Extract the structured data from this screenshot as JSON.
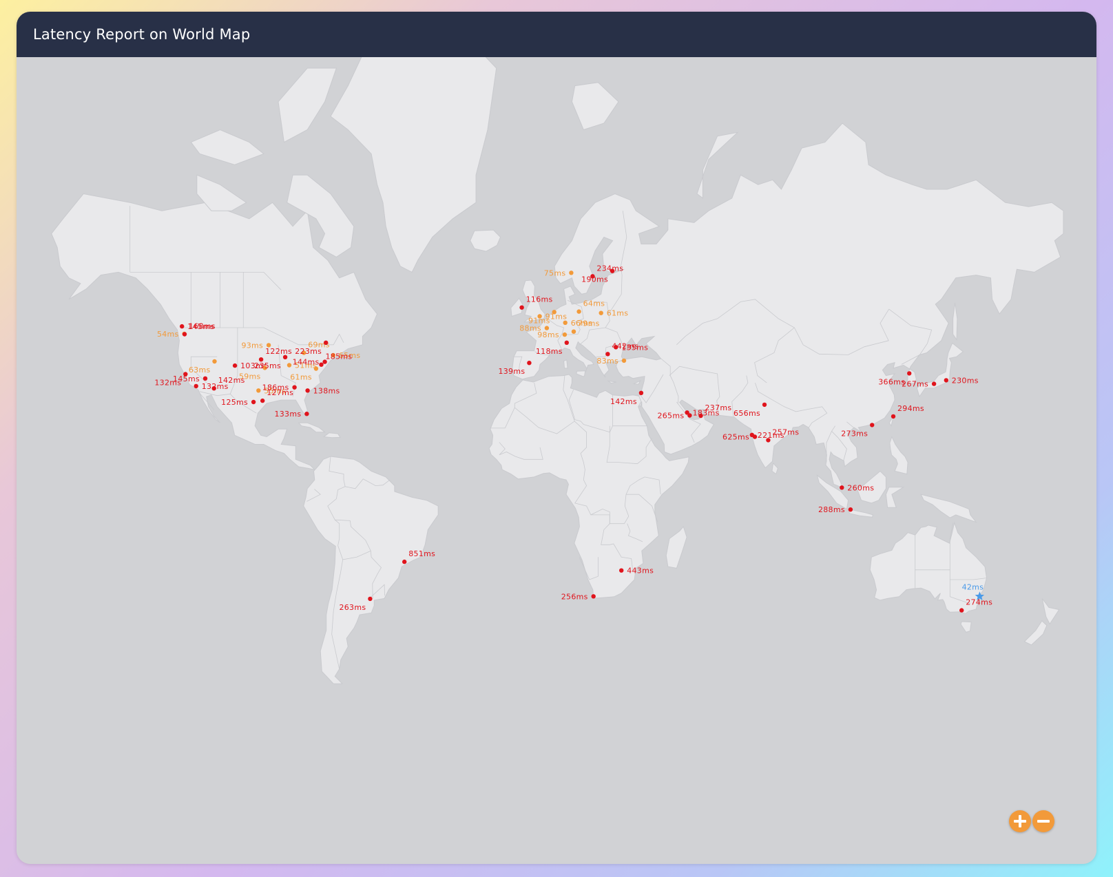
{
  "header": {
    "title": "Latency Report on World Map"
  },
  "colors": {
    "header_bg": "#283047",
    "ocean": "#d1d2d5",
    "land": "#e9e9eb",
    "high_latency": "#e0141c",
    "medium_latency": "#f29a3a",
    "home_node": "#4a9ae8"
  },
  "controls": {
    "zoom_in_icon": "plus-icon",
    "zoom_out_icon": "minus-icon"
  },
  "markers": [
    {
      "label": "145ms",
      "level": "high",
      "lat": 49.3,
      "lon": -123.1
    },
    {
      "label": "54ms",
      "level": "medium",
      "lat": 47.6,
      "lon": -122.3
    },
    {
      "label": "168ms",
      "level": "high",
      "lat": 47.5,
      "lon": -122.2
    },
    {
      "label": "132ms",
      "level": "high",
      "lat": 37.4,
      "lon": -121.9
    },
    {
      "label": "132ms",
      "level": "high",
      "lat": 34.05,
      "lon": -118.25
    },
    {
      "label": "145ms",
      "level": "high",
      "lat": 36.2,
      "lon": -115.1
    },
    {
      "label": "142ms",
      "level": "high",
      "lat": 33.4,
      "lon": -112.1
    },
    {
      "label": "63ms",
      "level": "medium",
      "lat": 40.8,
      "lon": -111.9
    },
    {
      "label": "103ms",
      "level": "high",
      "lat": 39.7,
      "lon": -104.9
    },
    {
      "label": "93ms",
      "level": "medium",
      "lat": 44.9,
      "lon": -93.3
    },
    {
      "label": "122ms",
      "level": "high",
      "lat": 41.3,
      "lon": -95.9
    },
    {
      "label": "59ms",
      "level": "medium",
      "lat": 39.1,
      "lon": -94.6
    },
    {
      "label": "55ms",
      "level": "medium",
      "lat": 32.8,
      "lon": -96.8
    },
    {
      "label": "125ms",
      "level": "high",
      "lat": 29.4,
      "lon": -98.5
    },
    {
      "label": "127ms",
      "level": "high",
      "lat": 29.8,
      "lon": -95.4
    },
    {
      "label": "235ms",
      "level": "high",
      "lat": 41.9,
      "lon": -87.6
    },
    {
      "label": "51ms",
      "level": "medium",
      "lat": 39.8,
      "lon": -86.2
    },
    {
      "label": "186ms",
      "level": "high",
      "lat": 33.7,
      "lon": -84.4
    },
    {
      "label": "69ms",
      "level": "medium",
      "lat": 43.0,
      "lon": -81.2
    },
    {
      "label": "223ms",
      "level": "high",
      "lat": 45.5,
      "lon": -73.6
    },
    {
      "label": "65ms",
      "level": "medium",
      "lat": 42.4,
      "lon": -71.1
    },
    {
      "label": "144ms",
      "level": "high",
      "lat": 40.7,
      "lon": -74.0
    },
    {
      "label": "185ms",
      "level": "high",
      "lat": 39.95,
      "lon": -75.2
    },
    {
      "label": "61ms",
      "level": "medium",
      "lat": 38.9,
      "lon": -77.0
    },
    {
      "label": "138ms",
      "level": "high",
      "lat": 32.8,
      "lon": -79.9
    },
    {
      "label": "133ms",
      "level": "high",
      "lat": 25.8,
      "lon": -80.2
    },
    {
      "label": "116ms",
      "level": "high",
      "lat": 53.35,
      "lon": -6.26
    },
    {
      "label": "139ms",
      "level": "high",
      "lat": 40.4,
      "lon": -3.7
    },
    {
      "label": "91ms",
      "level": "medium",
      "lat": 51.5,
      "lon": -0.1
    },
    {
      "label": "88ms",
      "level": "medium",
      "lat": 48.9,
      "lon": 2.35
    },
    {
      "label": "64ms",
      "level": "medium",
      "lat": 52.5,
      "lon": 13.4
    },
    {
      "label": "91ms",
      "level": "medium",
      "lat": 52.4,
      "lon": 4.9
    },
    {
      "label": "66ms",
      "level": "medium",
      "lat": 50.1,
      "lon": 8.7
    },
    {
      "label": "98ms",
      "level": "medium",
      "lat": 47.4,
      "lon": 8.5
    },
    {
      "label": "79ms",
      "level": "medium",
      "lat": 48.1,
      "lon": 11.6
    },
    {
      "label": "118ms",
      "level": "high",
      "lat": 45.5,
      "lon": 9.2
    },
    {
      "label": "61ms",
      "level": "medium",
      "lat": 52.2,
      "lon": 21.0
    },
    {
      "label": "75ms",
      "level": "medium",
      "lat": 59.9,
      "lon": 10.75
    },
    {
      "label": "234ms",
      "level": "high",
      "lat": 59.3,
      "lon": 18.1
    },
    {
      "label": "190ms",
      "level": "high",
      "lat": 60.2,
      "lon": 24.9
    },
    {
      "label": "135ms",
      "level": "high",
      "lat": 44.4,
      "lon": 26.1
    },
    {
      "label": "83ms",
      "level": "medium",
      "lat": 41.0,
      "lon": 28.9
    },
    {
      "label": "442ms",
      "level": "high",
      "lat": 42.7,
      "lon": 23.3
    },
    {
      "label": "142ms",
      "level": "high",
      "lat": 32.1,
      "lon": 34.8
    },
    {
      "label": "183ms",
      "level": "high",
      "lat": 26.2,
      "lon": 50.6
    },
    {
      "label": "265ms",
      "level": "high",
      "lat": 25.3,
      "lon": 51.5
    },
    {
      "label": "237ms",
      "level": "high",
      "lat": 25.2,
      "lon": 55.3
    },
    {
      "label": "656ms",
      "level": "high",
      "lat": 28.6,
      "lon": 77.2
    },
    {
      "label": "221ms",
      "level": "high",
      "lat": 19.1,
      "lon": 72.9
    },
    {
      "label": "625ms",
      "level": "high",
      "lat": 18.5,
      "lon": 73.9
    },
    {
      "label": "257ms",
      "level": "high",
      "lat": 17.4,
      "lon": 78.5
    },
    {
      "label": "366ms",
      "level": "high",
      "lat": 37.6,
      "lon": 127.0
    },
    {
      "label": "230ms",
      "level": "high",
      "lat": 35.7,
      "lon": 139.7
    },
    {
      "label": "267ms",
      "level": "high",
      "lat": 34.7,
      "lon": 135.5
    },
    {
      "label": "294ms",
      "level": "high",
      "lat": 25.0,
      "lon": 121.5
    },
    {
      "label": "273ms",
      "level": "high",
      "lat": 22.3,
      "lon": 114.2
    },
    {
      "label": "260ms",
      "level": "high",
      "lat": 1.35,
      "lon": 103.8
    },
    {
      "label": "288ms",
      "level": "high",
      "lat": -6.2,
      "lon": 106.8
    },
    {
      "label": "851ms",
      "level": "high",
      "lat": -23.5,
      "lon": -46.6
    },
    {
      "label": "263ms",
      "level": "high",
      "lat": -34.6,
      "lon": -58.4
    },
    {
      "label": "443ms",
      "level": "high",
      "lat": -26.2,
      "lon": 28.0
    },
    {
      "label": "256ms",
      "level": "high",
      "lat": -33.9,
      "lon": 18.4
    },
    {
      "label": "274ms",
      "level": "high",
      "lat": -37.8,
      "lon": 145.0
    },
    {
      "label": "42ms",
      "level": "home",
      "lat": -33.9,
      "lon": 151.2
    }
  ]
}
